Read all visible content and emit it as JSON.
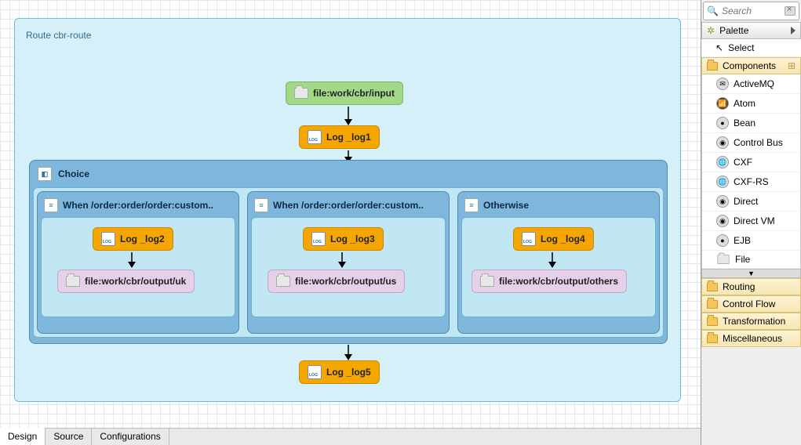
{
  "route": {
    "title": "Route cbr-route",
    "input_label": "file:work/cbr/input",
    "log1": "Log _log1",
    "choice_label": "Choice",
    "branches": [
      {
        "header": "When /order:order/order:custom..",
        "log": "Log _log2",
        "out": "file:work/cbr/output/uk"
      },
      {
        "header": "When /order:order/order:custom..",
        "log": "Log _log3",
        "out": "file:work/cbr/output/us"
      },
      {
        "header": "Otherwise",
        "log": "Log _log4",
        "out": "file:work/cbr/output/others"
      }
    ],
    "log5": "Log _log5"
  },
  "tabs": {
    "design": "Design",
    "source": "Source",
    "config": "Configurations"
  },
  "palette": {
    "search_placeholder": "Search",
    "title": "Palette",
    "select": "Select",
    "groups": {
      "components": "Components",
      "routing": "Routing",
      "controlflow": "Control Flow",
      "transformation": "Transformation",
      "misc": "Miscellaneous"
    },
    "components": [
      "ActiveMQ",
      "Atom",
      "Bean",
      "Control Bus",
      "CXF",
      "CXF-RS",
      "Direct",
      "Direct VM",
      "EJB",
      "File"
    ]
  }
}
